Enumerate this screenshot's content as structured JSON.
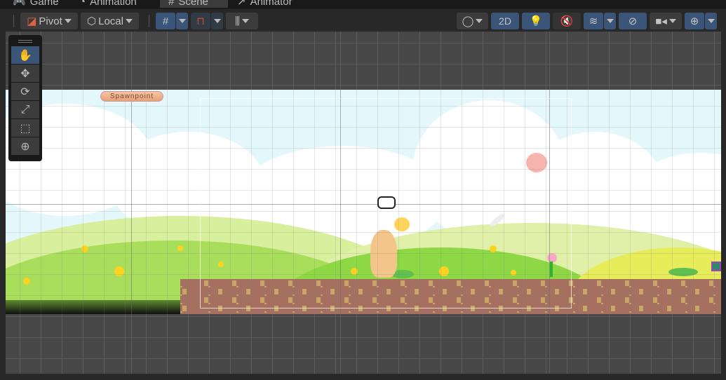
{
  "tabs": [
    {
      "label": "Game",
      "icon": "gamepad-icon"
    },
    {
      "label": "Animation",
      "icon": "clock-icon"
    },
    {
      "label": "Scene",
      "icon": "hash-icon",
      "active": true
    },
    {
      "label": "Animator",
      "icon": "animator-icon"
    }
  ],
  "toolbar": {
    "pivot": "Pivot",
    "local": "Local",
    "mode_2d": "2D"
  },
  "scene": {
    "spawnpoint_label": "Spawnpoint"
  },
  "tools": [
    "hand",
    "move",
    "rotate",
    "scale",
    "rect",
    "transform"
  ],
  "colors": {
    "active_blue": "#3a5578",
    "toolbar_bg": "#282828",
    "sky": "#e4f8fb"
  }
}
